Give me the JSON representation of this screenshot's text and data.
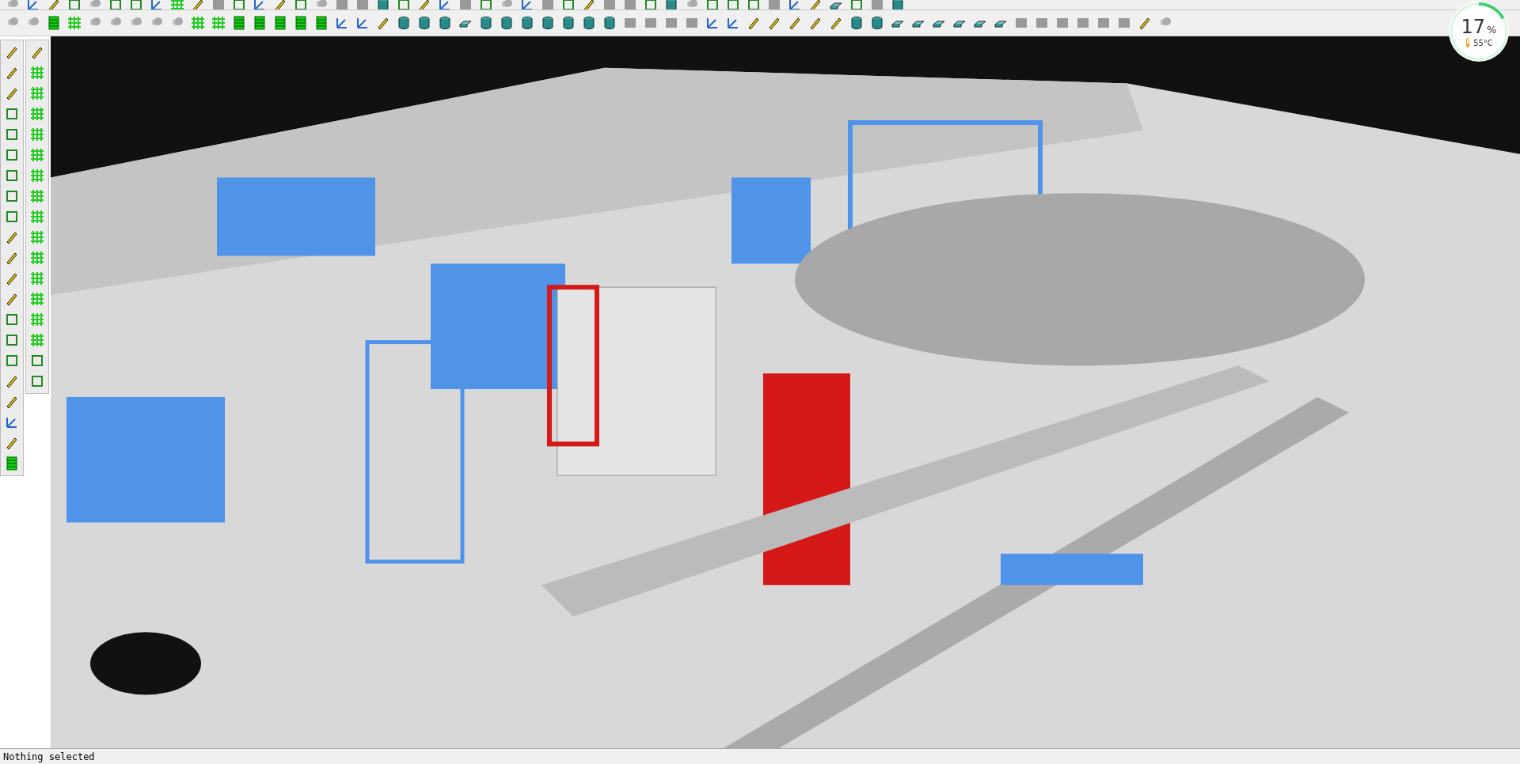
{
  "gauge": {
    "value": "17",
    "unit": "%",
    "level": 0.17,
    "temperature": "55°C"
  },
  "status_bar": {
    "text": "Nothing selected"
  }
}
